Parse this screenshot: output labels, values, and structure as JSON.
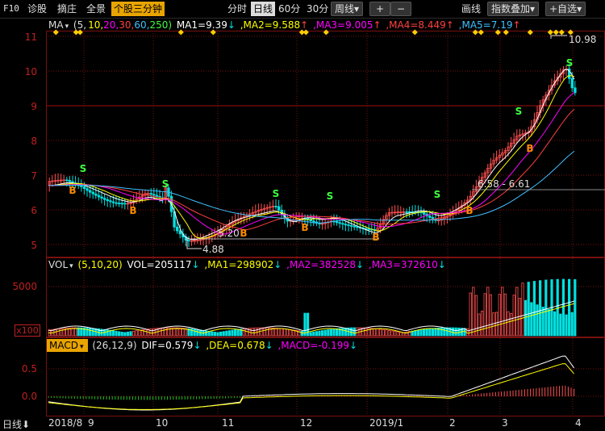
{
  "toolbar": {
    "f10": "F10",
    "diagnose": "诊股",
    "pick": "摘庄",
    "fullview": "全景",
    "active_tab": "个股三分钟",
    "periods": [
      "分时",
      "日线",
      "60分",
      "30分"
    ],
    "selected_period": "日线",
    "week": "周线",
    "week_arrow": "▾",
    "plus": "+",
    "minus": "−",
    "draw": "画线",
    "index_overlay": "指数叠加",
    "add_favorite": "+自选",
    "dropdown": "▾"
  },
  "ma_legend": {
    "name": "MA",
    "params_prefix": "(5,",
    "p10": "10,",
    "p20": "20,",
    "p30": "30,",
    "p60": "60,",
    "p250": "250)",
    "ma1": "MA1=9.39",
    "ma1_arrow": "↓",
    "ma2": ",MA2=9.588",
    "ma2_arrow": "↑",
    "ma3": ",MA3=9.005",
    "ma3_arrow": "↑",
    "ma4": ",MA4=8.449",
    "ma4_arrow": "↑",
    "ma5": ",MA5=7.19",
    "ma5_arrow": "↑"
  },
  "price_axis": [
    "11",
    "10",
    "9",
    "8",
    "7",
    "6",
    "5"
  ],
  "price_annotations": {
    "high": "10.98",
    "low": "4.88",
    "mark520": "5.20",
    "range": "6.58 - 6.61"
  },
  "vol_legend": {
    "name": "VOL",
    "params": "(5,10,20)",
    "vol": "VOL=205117",
    "vol_arrow": "↓",
    "ma1": ",MA1=298902",
    "ma1_arrow": "↓",
    "ma2": ",MA2=382528",
    "ma2_arrow": "↓",
    "ma3": ",MA3=372610",
    "ma3_arrow": "↓"
  },
  "vol_axis": {
    "top": "5000",
    "unit": "x100"
  },
  "macd_legend": {
    "name": "MACD",
    "params": "(26,12,9)",
    "dif": "DIF=0.579",
    "dif_arrow": "↓",
    "dea": ",DEA=0.678",
    "dea_arrow": "↓",
    "macd": ",MACD=-0.199",
    "macd_arrow": "↓"
  },
  "macd_axis": [
    "0.5",
    "0.0"
  ],
  "bottom": {
    "period_label": "日线",
    "period_arrow": "⬇",
    "dates": [
      "2018/8",
      "9",
      "10",
      "11",
      "12",
      "2019/1",
      "2",
      "3",
      "4"
    ]
  },
  "signals": {
    "buy": "B",
    "sell": "S"
  },
  "colors": {
    "up": "#ff5050",
    "down": "#00e0e0",
    "ma1": "#ffffff",
    "ma2": "#ffff00",
    "ma3": "#ff00ff",
    "ma4": "#ff4040",
    "ma5": "#40c0ff",
    "grid": "#7a1010",
    "axis_text": "#c02020",
    "buy": "#ff8c00",
    "sell": "#40ff40"
  }
}
